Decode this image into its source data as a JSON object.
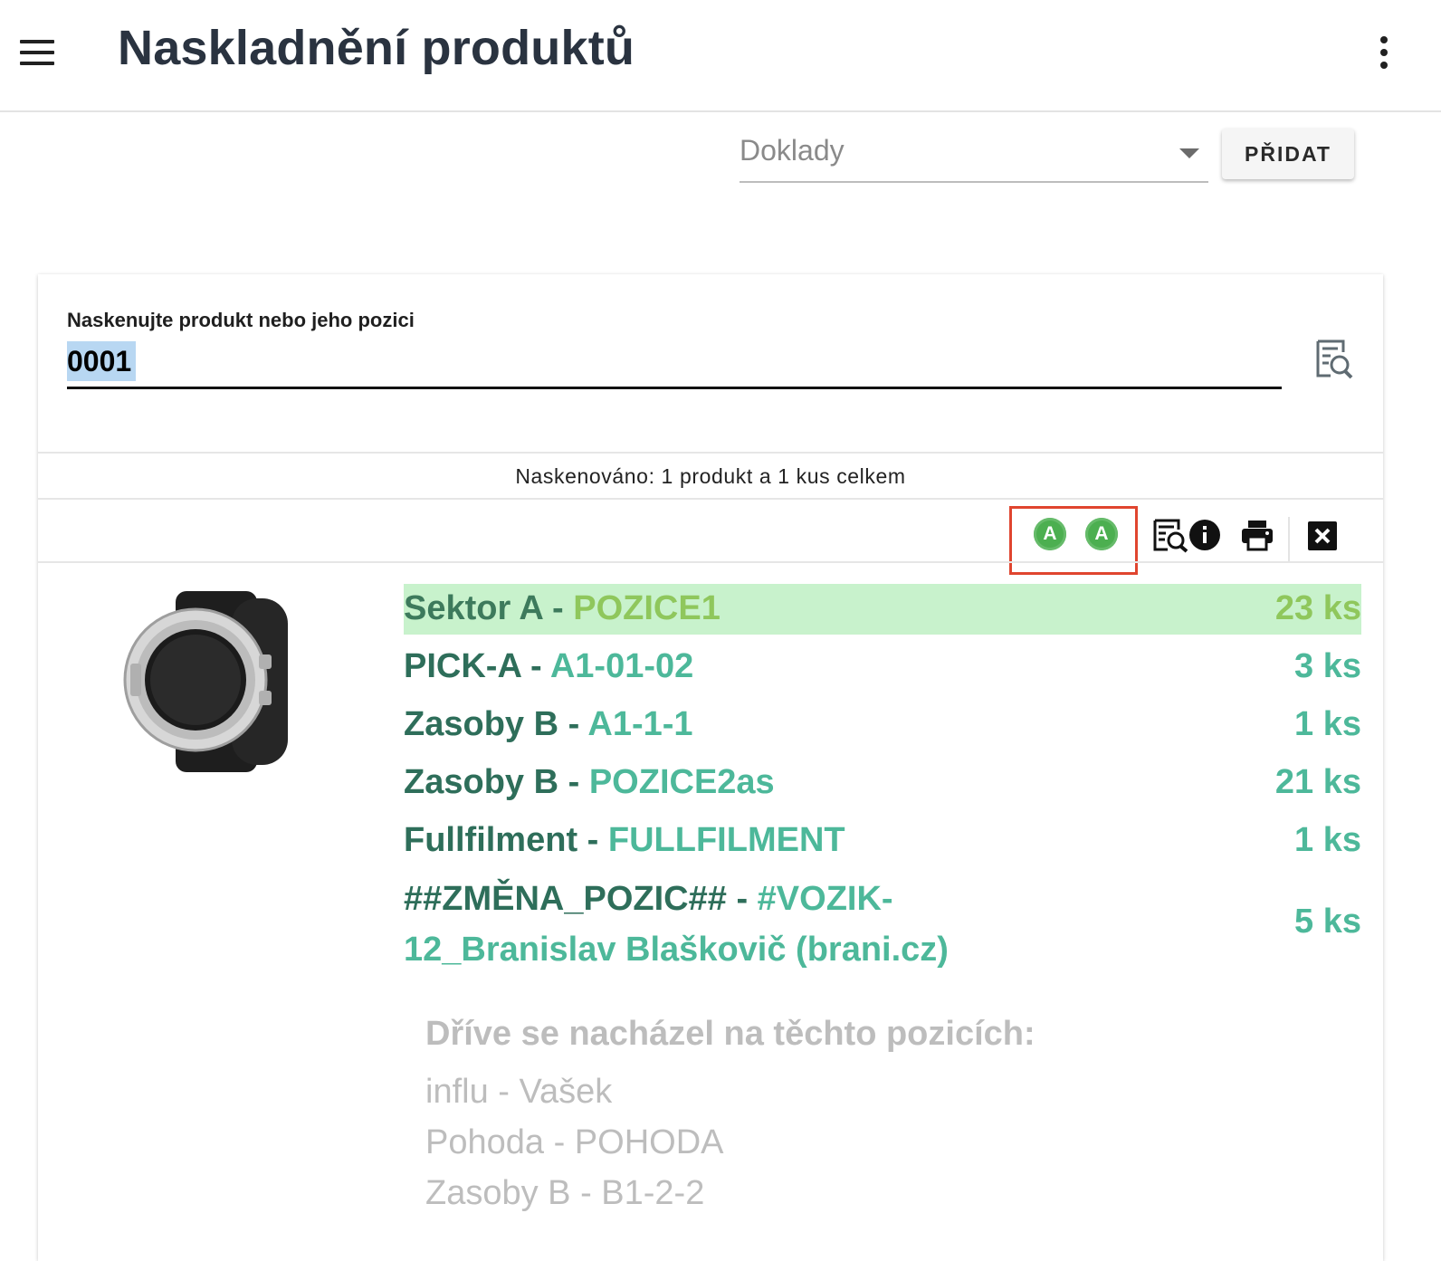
{
  "header": {
    "title": "Naskladnění produktů",
    "menu_icon": "hamburger-icon",
    "more_icon": "more-vert-icon"
  },
  "documents": {
    "label": "Doklady",
    "add_button": "PŘIDAT"
  },
  "scan": {
    "label": "Naskenujte produkt nebo jeho pozici",
    "value": "0001"
  },
  "summary": "Naskenováno: 1 produkt a 1 kus celkem",
  "toolbar": {
    "badge1": "A",
    "badge2": "A"
  },
  "positions": [
    {
      "name": "Sektor A",
      "separator": " - ",
      "code": "POZICE1",
      "qty": "23 ks"
    },
    {
      "name": "PICK-A",
      "separator": " - ",
      "code": "A1-01-02",
      "qty": "3 ks"
    },
    {
      "name": "Zasoby B",
      "separator": " - ",
      "code": "A1-1-1",
      "qty": "1 ks"
    },
    {
      "name": "Zasoby B",
      "separator": " - ",
      "code": "POZICE2as",
      "qty": "21 ks"
    },
    {
      "name": "Fullfilment",
      "separator": " - ",
      "code": "FULLFILMENT",
      "qty": "1 ks"
    },
    {
      "name": "##ZMĚNA_POZIC##",
      "separator": " - ",
      "code": "#VOZIK-12_Branislav Blaškovič (brani.cz)",
      "qty": "5 ks"
    }
  ],
  "previous": {
    "title": "Dříve se nacházel na těchto pozicích:",
    "items": [
      "influ -  Vašek",
      "Pohoda -  POHODA",
      "Zasoby B -  B1-2-2"
    ]
  },
  "colors": {
    "accent_green": "#4caf50",
    "highlight_row": "#c8f2cc",
    "position_name": "#2e6e5a",
    "position_code": "#4db89a",
    "frame_red": "#e0452f"
  }
}
